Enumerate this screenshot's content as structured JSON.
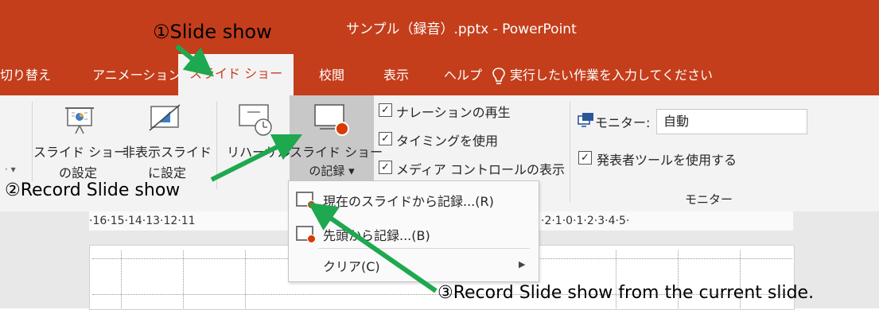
{
  "window": {
    "title": "サンプル（録音）.pptx  -  PowerPoint"
  },
  "tabs": {
    "transitions": "切り替え",
    "animations": "アニメーション",
    "slideshow": "スライド ショー",
    "review": "校閲",
    "view": "表示",
    "help": "ヘルプ",
    "tellme": "実行したい作業を入力してください"
  },
  "ribbon": {
    "setup_line1": "スライド ショー",
    "setup_line2": "の設定",
    "hide_line1": "非表示スライド",
    "hide_line2": "に設定",
    "rehearse": "リハーサル",
    "record_line1": "スライド ショー",
    "record_line2": "の記録 ▾",
    "play_narrations": "ナレーションの再生",
    "use_timings": "タイミングを使用",
    "show_media_controls": "メディア コントロールの表示",
    "monitor_label": "モニター:",
    "monitor_value": "自動",
    "presenter_view": "発表者ツールを使用する",
    "monitors_group": "モニター"
  },
  "ruler": {
    "left": "·16·15·14·13·12·11",
    "right": "·2·1·0·1·2·3·4·5·"
  },
  "menu": {
    "from_current": "現在のスライドから記録...(R)",
    "from_beginning": "先頭から記録...(B)",
    "clear": "クリア(C)"
  },
  "annotations": {
    "step1": "①Slide show",
    "step2": "②Record Slide show",
    "step3": "③Record Slide show from the current slide."
  },
  "colors": {
    "brand": "#c43e1c",
    "annotation_arrow": "#1ea84f",
    "record_dot": "#d83b01"
  },
  "icons": [
    "lightbulb-icon",
    "monitor-icon",
    "setup-slideshow-icon",
    "hide-slide-icon",
    "rehearse-icon",
    "record-slideshow-icon",
    "submenu-arrow-icon"
  ]
}
